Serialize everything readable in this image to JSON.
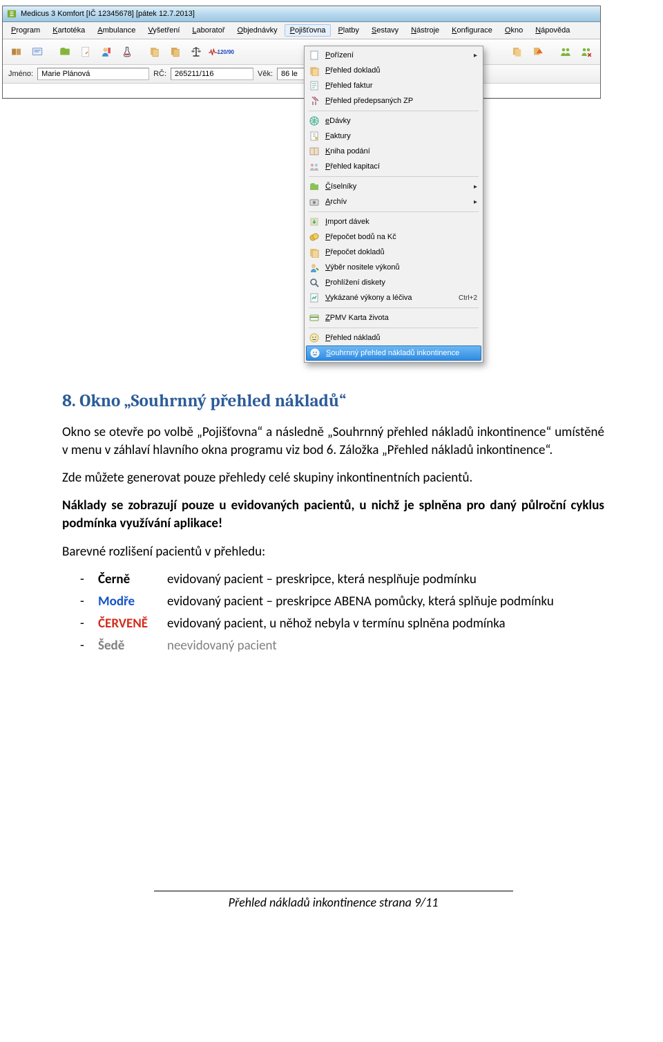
{
  "app": {
    "title": "Medicus 3 Komfort  [IČ 12345678]  [pátek 12.7.2013]",
    "menubar": [
      "Program",
      "Kartotéka",
      "Ambulance",
      "Vyšetření",
      "Laboratoř",
      "Objednávky",
      "Pojišťovna",
      "Platby",
      "Sestavy",
      "Nástroje",
      "Konfigurace",
      "Okno",
      "Nápověda"
    ],
    "menubar_active_index": 6,
    "toolbar_bp": "120/90",
    "infobar": {
      "name_label": "Jméno:",
      "name_value": "Marie Plánová",
      "rc_label": "RČ:",
      "rc_value": "265211/116",
      "age_label": "Věk:",
      "age_value": "86 le"
    },
    "menu_items": [
      {
        "label": "Pořízení",
        "icon": "blank-doc",
        "submenu": true
      },
      {
        "label": "Přehled dokladů",
        "icon": "docs"
      },
      {
        "label": "Přehled faktur",
        "icon": "invoice"
      },
      {
        "label": "Přehled předepsaných ZP",
        "icon": "crutch"
      },
      {
        "sep": true
      },
      {
        "label": "eDávky",
        "icon": "globe"
      },
      {
        "label": "Faktury",
        "icon": "invoice2"
      },
      {
        "label": "Kniha podání",
        "icon": "book"
      },
      {
        "label": "Přehled kapitací",
        "icon": "people"
      },
      {
        "sep": true
      },
      {
        "label": "Číselníky",
        "icon": "folder",
        "submenu": true
      },
      {
        "label": "Archív",
        "icon": "camera",
        "submenu": true
      },
      {
        "sep": true
      },
      {
        "label": "Import dávek",
        "icon": "import"
      },
      {
        "label": "Přepočet bodů na Kč",
        "icon": "money"
      },
      {
        "label": "Přepočet dokladů",
        "icon": "docs"
      },
      {
        "label": "Výběr nositele výkonů",
        "icon": "user-pick"
      },
      {
        "label": "Prohlížení diskety",
        "icon": "search"
      },
      {
        "label": "Vykázané výkony a léčiva",
        "icon": "report",
        "shortcut": "Ctrl+2"
      },
      {
        "sep": true
      },
      {
        "label": "ZPMV Karta života",
        "icon": "card"
      },
      {
        "sep": true
      },
      {
        "label": "Přehled nákladů",
        "icon": "neutral"
      },
      {
        "label": "Souhrnný přehled nákladů inkontinence",
        "icon": "neutral",
        "highlight": true
      }
    ]
  },
  "doc": {
    "heading": "8.   Okno „Souhrnný přehled nákladů“",
    "p1": "Okno se otevře po volbě „Pojišťovna“ a následně „Souhrnný přehled nákladů inkontinence“ umístěné v menu v záhlaví hlavního okna programu viz bod 6. Záložka „Přehled nákladů inkontinence“.",
    "p2": "Zde můžete generovat pouze přehledy celé skupiny inkontinentních pacientů.",
    "p3": "Náklady se zobrazují pouze u evidovaných pacientů, u nichž je splněna pro daný půlroční cyklus podmínka využívání aplikace!",
    "p4": "Barevné rozlišení pacientů v přehledu:",
    "legend": [
      {
        "tag": "Černě",
        "cls": "",
        "desc": "evidovaný pacient – preskripce, která nesplňuje podmínku"
      },
      {
        "tag": "Modře",
        "cls": "blue",
        "desc": "evidovaný pacient – preskripce ABENA pomůcky, která splňuje podmínku"
      },
      {
        "tag": "ČERVENĚ",
        "cls": "red",
        "desc": "evidovaný pacient, u něhož nebyla v termínu splněna podmínka"
      },
      {
        "tag": "Šedě",
        "cls": "grey",
        "desc": "neevidovaný pacient",
        "desccls": "grey"
      }
    ],
    "footer": "Přehled nákladů inkontinence strana 9/11"
  }
}
